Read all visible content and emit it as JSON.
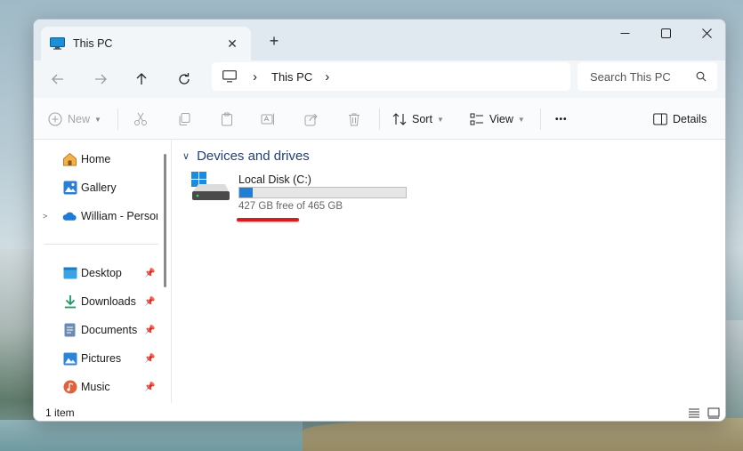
{
  "window": {
    "tab_title": "This PC",
    "tab_close": "✕",
    "new_tab": "+"
  },
  "nav": {
    "breadcrumb_current": "This PC",
    "breadcrumb_sep": "›",
    "search_placeholder": "Search This PC"
  },
  "toolbar": {
    "new_label": "New",
    "sort_label": "Sort",
    "view_label": "View",
    "details_label": "Details",
    "more_label": "•••"
  },
  "sidebar": {
    "items": [
      {
        "label": "Home",
        "icon": "home-icon"
      },
      {
        "label": "Gallery",
        "icon": "gallery-icon"
      },
      {
        "label": "William - Personal",
        "icon": "onedrive-icon"
      },
      {
        "label": "Desktop",
        "icon": "desktop-icon"
      },
      {
        "label": "Downloads",
        "icon": "downloads-icon"
      },
      {
        "label": "Documents",
        "icon": "documents-icon"
      },
      {
        "label": "Pictures",
        "icon": "pictures-icon"
      },
      {
        "label": "Music",
        "icon": "music-icon"
      }
    ]
  },
  "content": {
    "group_title": "Devices and drives",
    "drive": {
      "name": "Local Disk (C:)",
      "free_text": "427 GB free of 465 GB",
      "used_fraction": 0.082,
      "bar_color": "#1f7fd6"
    }
  },
  "status": {
    "item_count": "1 item"
  },
  "colors": {
    "accent": "#1f7fd6",
    "annotation_underline": "#d61e1e"
  }
}
